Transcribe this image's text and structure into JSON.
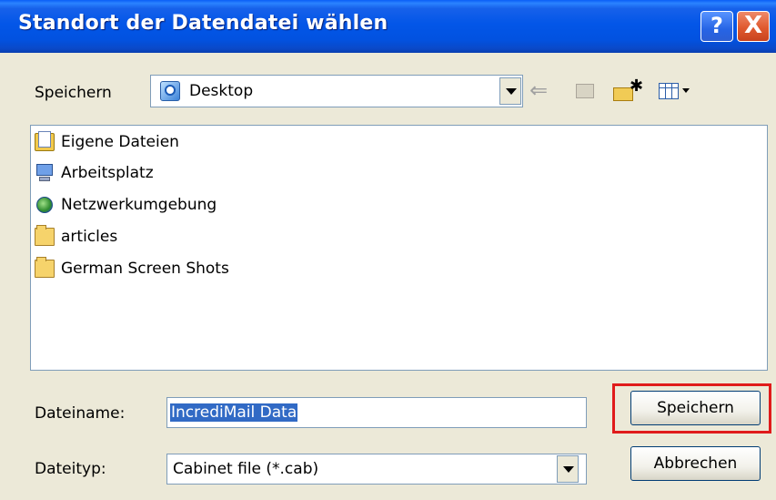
{
  "window": {
    "title": "Standort der Datendatei wählen",
    "help_glyph": "?",
    "close_glyph": "X"
  },
  "location": {
    "label": "Speichern",
    "value": "Desktop"
  },
  "toolbar": {
    "back_glyph": "⇐"
  },
  "file_list": [
    {
      "name": "Eigene Dateien",
      "icon": "my-documents-icon"
    },
    {
      "name": "Arbeitsplatz",
      "icon": "my-computer-icon"
    },
    {
      "name": "Netzwerkumgebung",
      "icon": "network-places-icon"
    },
    {
      "name": "articles",
      "icon": "folder-icon"
    },
    {
      "name": "German Screen Shots",
      "icon": "folder-icon"
    }
  ],
  "filename": {
    "label": "Dateiname:",
    "value": "IncrediMail Data"
  },
  "filetype": {
    "label": "Dateityp:",
    "value": "Cabinet file (*.cab)"
  },
  "buttons": {
    "save": "Speichern",
    "cancel": "Abbrechen"
  },
  "colors": {
    "titlebar": "#0356e8",
    "dialog_bg": "#ece9d8",
    "highlight": "#e01b1b",
    "selection": "#316ac5"
  }
}
